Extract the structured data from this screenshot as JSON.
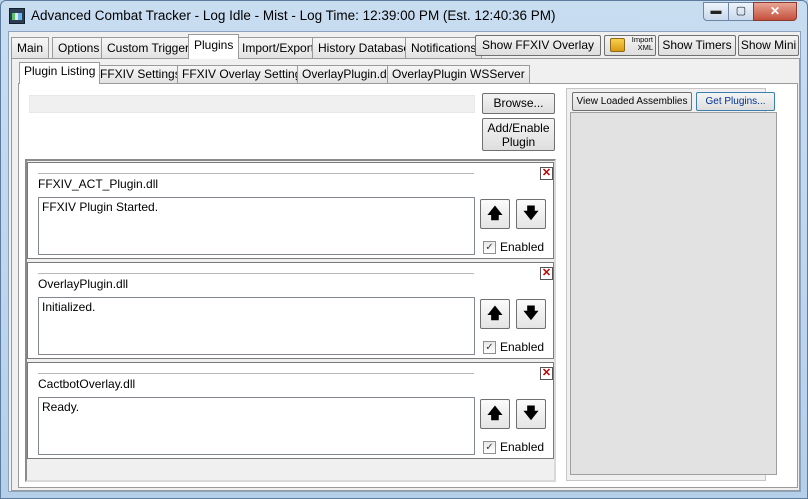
{
  "window": {
    "title": "Advanced Combat Tracker - Log Idle - Mist - Log Time: 12:39:00 PM (Est. 12:40:36 PM)",
    "buttons": {
      "minimize": "▬",
      "maximize": "▢",
      "close": "✕"
    }
  },
  "main_tabs": [
    {
      "label": "Main"
    },
    {
      "label": "Options"
    },
    {
      "label": "Custom Triggers"
    },
    {
      "label": "Plugins"
    },
    {
      "label": "Import/Export"
    },
    {
      "label": "History Database"
    },
    {
      "label": "Notifications"
    }
  ],
  "toolbar": {
    "show_ffxiv_overlay": "Show FFXIV Overlay",
    "import_xml_line1": "Import",
    "import_xml_line2": "XML",
    "show_timers": "Show Timers",
    "show_mini": "Show Mini"
  },
  "plugin_tabs": [
    {
      "label": "Plugin Listing"
    },
    {
      "label": "FFXIV Settings"
    },
    {
      "label": "FFXIV Overlay Settings"
    },
    {
      "label": "OverlayPlugin.dll"
    },
    {
      "label": "OverlayPlugin WSServer"
    }
  ],
  "listing": {
    "path_value": "",
    "browse_label": "Browse...",
    "add_enable_line1": "Add/Enable",
    "add_enable_line2": "Plugin",
    "view_assemblies_label": "View Loaded Assemblies",
    "get_plugins_label": "Get Plugins..."
  },
  "plugins": [
    {
      "name": "FFXIV_ACT_Plugin.dll",
      "status": "FFXIV Plugin Started.",
      "enabled_label": "Enabled",
      "enabled": true
    },
    {
      "name": "OverlayPlugin.dll",
      "status": "Initialized.",
      "enabled_label": "Enabled",
      "enabled": true
    },
    {
      "name": "CactbotOverlay.dll",
      "status": "Ready.",
      "enabled_label": "Enabled",
      "enabled": true
    }
  ],
  "glyphs": {
    "remove": "✕",
    "up": "🡅",
    "down": "🡇",
    "check": "✓"
  },
  "colors": {
    "title_bar": "#bcd3ea",
    "close_button": "#c4503b",
    "remove_x": "#c00000"
  }
}
